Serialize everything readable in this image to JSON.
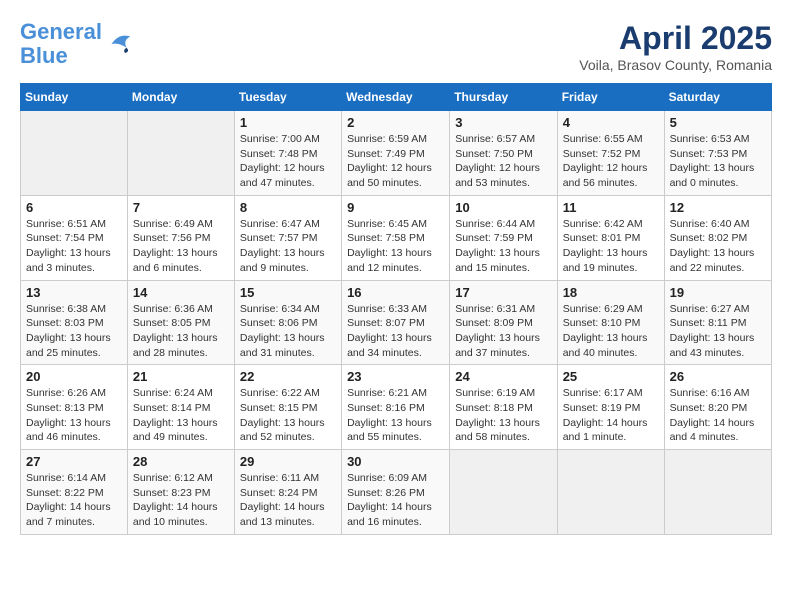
{
  "header": {
    "logo_line1": "General",
    "logo_line2": "Blue",
    "title": "April 2025",
    "subtitle": "Voila, Brasov County, Romania"
  },
  "weekdays": [
    "Sunday",
    "Monday",
    "Tuesday",
    "Wednesday",
    "Thursday",
    "Friday",
    "Saturday"
  ],
  "weeks": [
    [
      {
        "day": "",
        "info": ""
      },
      {
        "day": "",
        "info": ""
      },
      {
        "day": "1",
        "info": "Sunrise: 7:00 AM\nSunset: 7:48 PM\nDaylight: 12 hours and 47 minutes."
      },
      {
        "day": "2",
        "info": "Sunrise: 6:59 AM\nSunset: 7:49 PM\nDaylight: 12 hours and 50 minutes."
      },
      {
        "day": "3",
        "info": "Sunrise: 6:57 AM\nSunset: 7:50 PM\nDaylight: 12 hours and 53 minutes."
      },
      {
        "day": "4",
        "info": "Sunrise: 6:55 AM\nSunset: 7:52 PM\nDaylight: 12 hours and 56 minutes."
      },
      {
        "day": "5",
        "info": "Sunrise: 6:53 AM\nSunset: 7:53 PM\nDaylight: 13 hours and 0 minutes."
      }
    ],
    [
      {
        "day": "6",
        "info": "Sunrise: 6:51 AM\nSunset: 7:54 PM\nDaylight: 13 hours and 3 minutes."
      },
      {
        "day": "7",
        "info": "Sunrise: 6:49 AM\nSunset: 7:56 PM\nDaylight: 13 hours and 6 minutes."
      },
      {
        "day": "8",
        "info": "Sunrise: 6:47 AM\nSunset: 7:57 PM\nDaylight: 13 hours and 9 minutes."
      },
      {
        "day": "9",
        "info": "Sunrise: 6:45 AM\nSunset: 7:58 PM\nDaylight: 13 hours and 12 minutes."
      },
      {
        "day": "10",
        "info": "Sunrise: 6:44 AM\nSunset: 7:59 PM\nDaylight: 13 hours and 15 minutes."
      },
      {
        "day": "11",
        "info": "Sunrise: 6:42 AM\nSunset: 8:01 PM\nDaylight: 13 hours and 19 minutes."
      },
      {
        "day": "12",
        "info": "Sunrise: 6:40 AM\nSunset: 8:02 PM\nDaylight: 13 hours and 22 minutes."
      }
    ],
    [
      {
        "day": "13",
        "info": "Sunrise: 6:38 AM\nSunset: 8:03 PM\nDaylight: 13 hours and 25 minutes."
      },
      {
        "day": "14",
        "info": "Sunrise: 6:36 AM\nSunset: 8:05 PM\nDaylight: 13 hours and 28 minutes."
      },
      {
        "day": "15",
        "info": "Sunrise: 6:34 AM\nSunset: 8:06 PM\nDaylight: 13 hours and 31 minutes."
      },
      {
        "day": "16",
        "info": "Sunrise: 6:33 AM\nSunset: 8:07 PM\nDaylight: 13 hours and 34 minutes."
      },
      {
        "day": "17",
        "info": "Sunrise: 6:31 AM\nSunset: 8:09 PM\nDaylight: 13 hours and 37 minutes."
      },
      {
        "day": "18",
        "info": "Sunrise: 6:29 AM\nSunset: 8:10 PM\nDaylight: 13 hours and 40 minutes."
      },
      {
        "day": "19",
        "info": "Sunrise: 6:27 AM\nSunset: 8:11 PM\nDaylight: 13 hours and 43 minutes."
      }
    ],
    [
      {
        "day": "20",
        "info": "Sunrise: 6:26 AM\nSunset: 8:13 PM\nDaylight: 13 hours and 46 minutes."
      },
      {
        "day": "21",
        "info": "Sunrise: 6:24 AM\nSunset: 8:14 PM\nDaylight: 13 hours and 49 minutes."
      },
      {
        "day": "22",
        "info": "Sunrise: 6:22 AM\nSunset: 8:15 PM\nDaylight: 13 hours and 52 minutes."
      },
      {
        "day": "23",
        "info": "Sunrise: 6:21 AM\nSunset: 8:16 PM\nDaylight: 13 hours and 55 minutes."
      },
      {
        "day": "24",
        "info": "Sunrise: 6:19 AM\nSunset: 8:18 PM\nDaylight: 13 hours and 58 minutes."
      },
      {
        "day": "25",
        "info": "Sunrise: 6:17 AM\nSunset: 8:19 PM\nDaylight: 14 hours and 1 minute."
      },
      {
        "day": "26",
        "info": "Sunrise: 6:16 AM\nSunset: 8:20 PM\nDaylight: 14 hours and 4 minutes."
      }
    ],
    [
      {
        "day": "27",
        "info": "Sunrise: 6:14 AM\nSunset: 8:22 PM\nDaylight: 14 hours and 7 minutes."
      },
      {
        "day": "28",
        "info": "Sunrise: 6:12 AM\nSunset: 8:23 PM\nDaylight: 14 hours and 10 minutes."
      },
      {
        "day": "29",
        "info": "Sunrise: 6:11 AM\nSunset: 8:24 PM\nDaylight: 14 hours and 13 minutes."
      },
      {
        "day": "30",
        "info": "Sunrise: 6:09 AM\nSunset: 8:26 PM\nDaylight: 14 hours and 16 minutes."
      },
      {
        "day": "",
        "info": ""
      },
      {
        "day": "",
        "info": ""
      },
      {
        "day": "",
        "info": ""
      }
    ]
  ]
}
